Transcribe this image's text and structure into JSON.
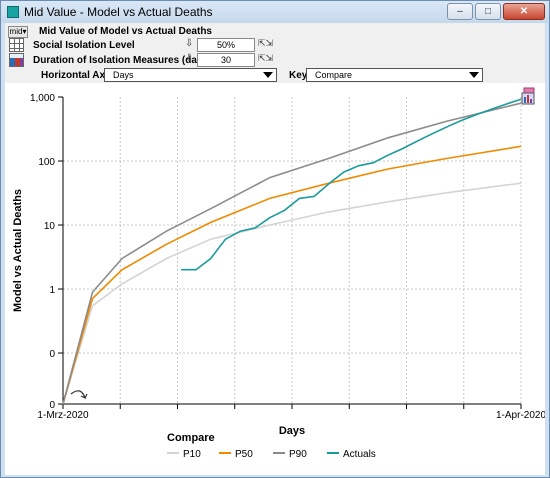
{
  "window": {
    "title": "Mid Value - Model vs Actual Deaths",
    "min_label": "–",
    "max_label": "□",
    "close_label": "✕"
  },
  "controls": {
    "mid_button": "mid▾",
    "title": "Mid Value of Model vs Actual Deaths",
    "inputs": [
      {
        "label": "Social Isolation Level",
        "value": "50%"
      },
      {
        "label": "Duration of Isolation Measures  (days)",
        "value": "30"
      }
    ],
    "horizontal_axis_label": "Horizontal Axis:",
    "horizontal_axis_value": "Days",
    "key_label": "Key:",
    "key_value": "Compare"
  },
  "chart_data": {
    "type": "line",
    "scale": "log",
    "ylabel": "Model vs Actual Deaths",
    "xlabel": "Days",
    "x_start_label": "1-Mrz-2020",
    "x_end_label": "1-Apr-2020",
    "x_range": [
      "2020-03-01",
      "2020-04-01"
    ],
    "y_tick_labels": [
      "1,000",
      "100",
      "10",
      "1",
      "0",
      "0"
    ],
    "grid": true,
    "legend_title": "Compare",
    "legend_position": "bottom",
    "series": [
      {
        "name": "P10",
        "color": "#d4d4d4",
        "x": [
          "2020-03-01",
          "2020-03-03",
          "2020-03-05",
          "2020-03-08",
          "2020-03-11",
          "2020-03-15",
          "2020-03-19",
          "2020-03-23",
          "2020-03-27",
          "2020-04-01"
        ],
        "y": [
          0.01,
          0.3,
          1.2,
          3,
          6,
          10,
          16,
          23,
          32,
          45
        ]
      },
      {
        "name": "P50",
        "color": "#f08a00",
        "x": [
          "2020-03-01",
          "2020-03-03",
          "2020-03-05",
          "2020-03-08",
          "2020-03-11",
          "2020-03-15",
          "2020-03-19",
          "2020-03-23",
          "2020-03-27",
          "2020-04-01"
        ],
        "y": [
          0.01,
          0.5,
          2,
          5,
          11,
          26,
          45,
          75,
          110,
          170
        ]
      },
      {
        "name": "P90",
        "color": "#8c8c8c",
        "x": [
          "2020-03-01",
          "2020-03-03",
          "2020-03-05",
          "2020-03-08",
          "2020-03-11",
          "2020-03-15",
          "2020-03-19",
          "2020-03-23",
          "2020-03-27",
          "2020-04-01"
        ],
        "y": [
          0.01,
          0.8,
          3,
          8,
          18,
          55,
          110,
          230,
          420,
          800
        ]
      },
      {
        "name": "Actuals",
        "color": "#1a9b9b",
        "x": [
          "2020-03-09",
          "2020-03-10",
          "2020-03-11",
          "2020-03-12",
          "2020-03-13",
          "2020-03-14",
          "2020-03-15",
          "2020-03-16",
          "2020-03-17",
          "2020-03-18",
          "2020-03-19",
          "2020-03-20",
          "2020-03-21",
          "2020-03-22",
          "2020-03-23",
          "2020-03-24",
          "2020-03-25",
          "2020-03-26",
          "2020-03-27",
          "2020-03-28",
          "2020-03-29",
          "2020-03-30",
          "2020-03-31",
          "2020-04-01"
        ],
        "y": [
          2,
          2,
          3,
          6,
          8,
          9,
          13,
          17,
          26,
          28,
          44,
          67,
          84,
          94,
          123,
          157,
          206,
          267,
          342,
          433,
          533,
          645,
          775,
          920
        ]
      }
    ]
  }
}
